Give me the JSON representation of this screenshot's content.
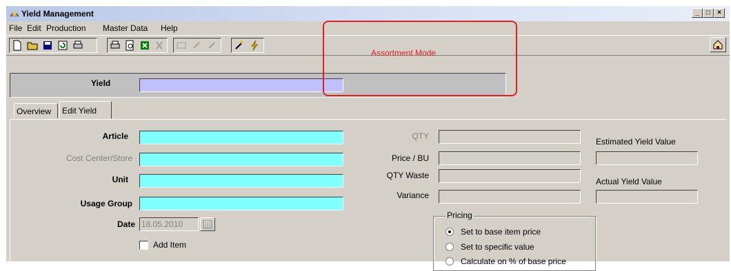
{
  "window": {
    "title": "Yield Management",
    "controls": [
      "_",
      "□",
      "×"
    ]
  },
  "menu": [
    "File",
    "Edit",
    "Production",
    "Master Data",
    "Help"
  ],
  "toolbar": {
    "mode_label": "Assortment Mode"
  },
  "header": {
    "yield_label": "Yield",
    "yield_value": ""
  },
  "tabs": [
    {
      "label": "Overview",
      "active": false
    },
    {
      "label": "Edit Yield",
      "active": true
    }
  ],
  "form": {
    "article_label": "Article",
    "cost_center_label": "Cost Center/Store",
    "unit_label": "Unit",
    "usage_group_label": "Usage Group",
    "date_label": "Date",
    "date_value": "18.05.2010",
    "add_item_label": "Add Item",
    "add_item_checked": false
  },
  "quantities": {
    "qty_label": "QTY",
    "price_label": "Price / BU",
    "qty_waste_label": "QTY Waste",
    "variance_label": "Variance"
  },
  "yield_values": {
    "estimated_label": "Estimated Yield Value",
    "actual_label": "Actual Yield Value"
  },
  "pricing": {
    "title": "Pricing",
    "options": [
      {
        "label": "Set to base item price",
        "selected": true
      },
      {
        "label": "Set to specific value",
        "selected": false
      },
      {
        "label": "Calculate on % of base price",
        "selected": false
      }
    ]
  },
  "colors": {
    "highlight": "#e02020",
    "cyan_field": "#80ffff",
    "yield_field": "#c0c0ff"
  }
}
